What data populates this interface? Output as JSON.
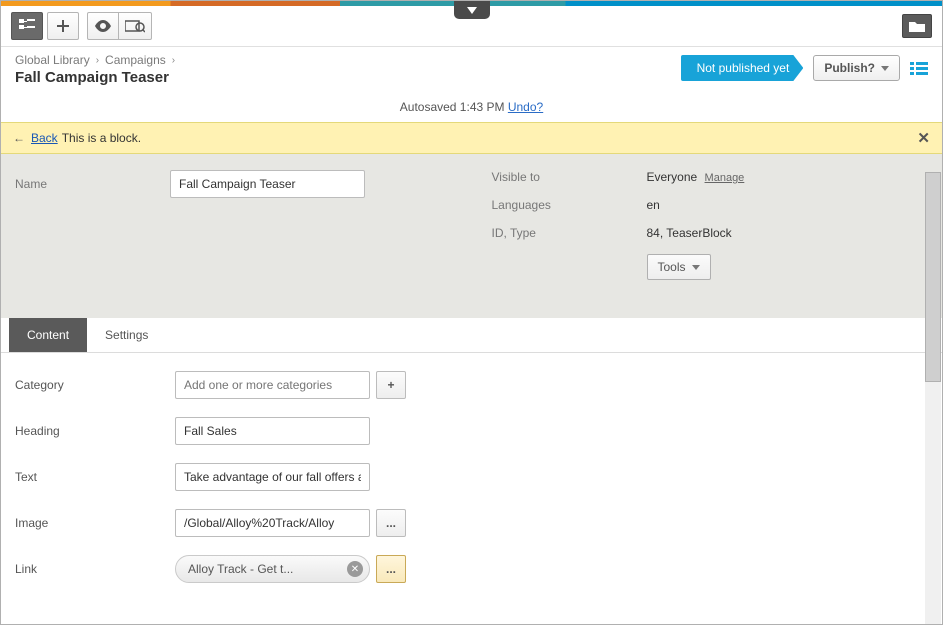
{
  "breadcrumb": {
    "root": "Global Library",
    "section": "Campaigns"
  },
  "title": "Fall Campaign Teaser",
  "status": {
    "label": "Not published yet",
    "publish_button": "Publish?"
  },
  "autosave": {
    "text": "Autosaved 1:43 PM",
    "undo": "Undo?"
  },
  "notice": {
    "back": "Back",
    "text": "This is a block."
  },
  "meta": {
    "name_label": "Name",
    "name_value": "Fall Campaign Teaser",
    "visible_label": "Visible to",
    "visible_value": "Everyone",
    "visible_manage": "Manage",
    "languages_label": "Languages",
    "languages_value": "en",
    "idtype_label": "ID, Type",
    "idtype_value": "84, TeaserBlock",
    "tools": "Tools"
  },
  "tabs": {
    "content": "Content",
    "settings": "Settings"
  },
  "form": {
    "category_label": "Category",
    "category_placeholder": "Add one or more categories",
    "category_add": "+",
    "heading_label": "Heading",
    "heading_value": "Fall Sales",
    "text_label": "Text",
    "text_value": "Take advantage of our fall offers and save big on your next purchase.",
    "image_label": "Image",
    "image_value": "/Global/Alloy%20Track/Alloy",
    "browse": "...",
    "link_label": "Link",
    "link_chip": "Alloy Track - Get t..."
  }
}
